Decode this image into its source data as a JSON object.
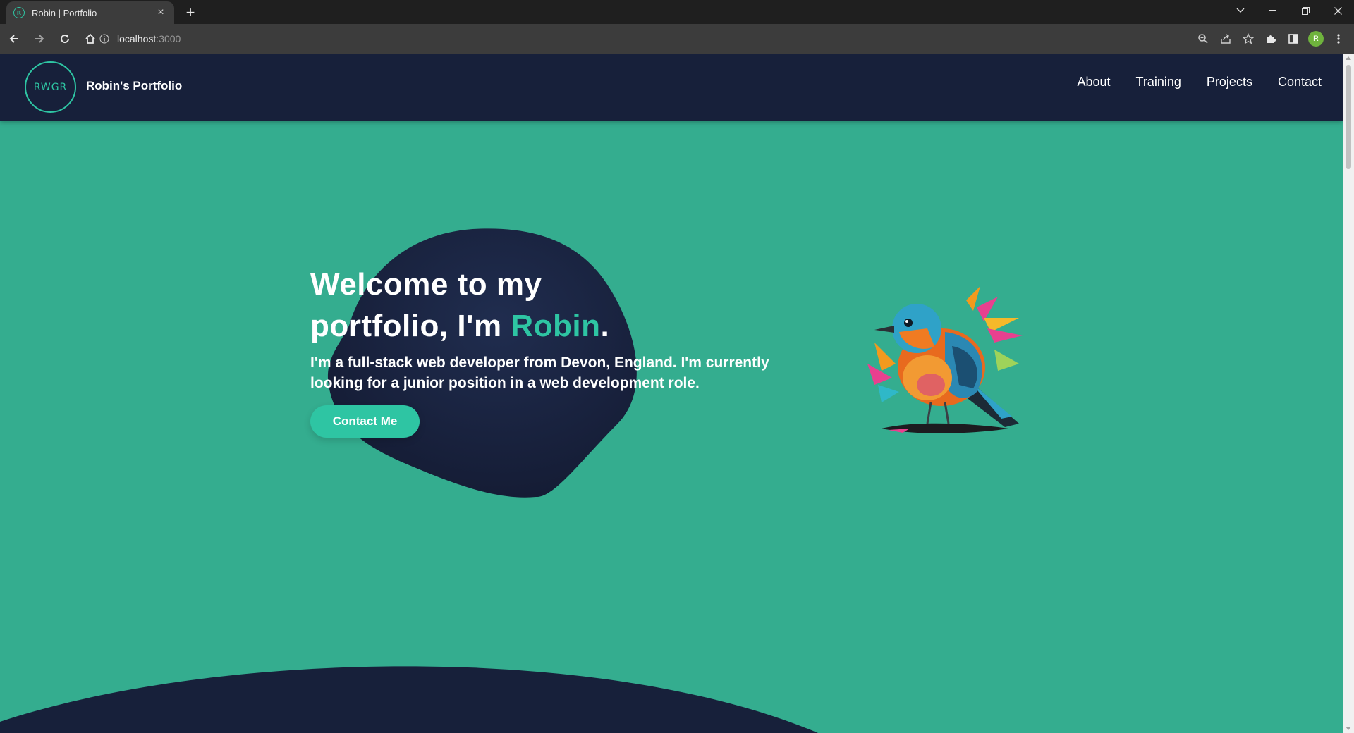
{
  "browser": {
    "tab_title": "Robin | Portfolio",
    "tab_favicon_letter": "R",
    "url_host": "localhost",
    "url_port": ":3000",
    "profile_initial": "R"
  },
  "site": {
    "logo_text": "RWGR",
    "brand": "Robin's Portfolio",
    "nav": [
      "About",
      "Training",
      "Projects",
      "Contact"
    ]
  },
  "hero": {
    "title_line1": "Welcome to my",
    "title_line2_prefix": "portfolio, I'm ",
    "title_name": "Robin",
    "title_suffix": ".",
    "subtitle": "I'm a full-stack web developer from Devon, England. I'm currently looking for a junior position in a web development role.",
    "cta_label": "Contact Me"
  },
  "colors": {
    "background": "#34ad8f",
    "header": "#17203a",
    "accent": "#2ec5a3"
  }
}
